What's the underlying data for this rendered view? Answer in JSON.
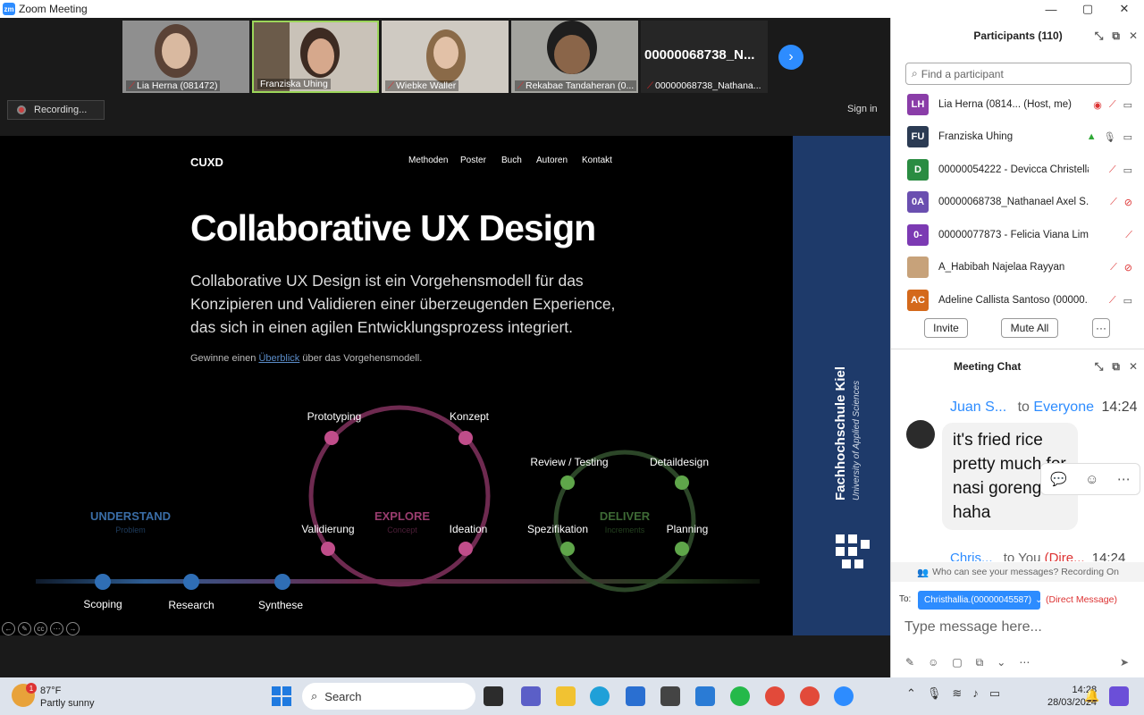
{
  "window": {
    "title": "Zoom Meeting"
  },
  "gallery": {
    "tiles": [
      {
        "name": "Lia Herna (081472)",
        "muted": true
      },
      {
        "name": "Franziska Uhing",
        "muted": false
      },
      {
        "name": "Wiebke Waller",
        "muted": true
      },
      {
        "name": "Rekabae Tandaheran (0...",
        "muted": true
      },
      {
        "name": "00000068738_Nathana...",
        "muted": true,
        "big_label": "00000068738_N..."
      }
    ]
  },
  "recording": {
    "label": "Recording..."
  },
  "signin": {
    "label": "Sign in"
  },
  "shared": {
    "brand": "CUXD",
    "nav": [
      "Methoden",
      "Poster",
      "Buch",
      "Autoren",
      "Kontakt"
    ],
    "title": "Collaborative UX Design",
    "lead": "Collaborative UX Design ist ein Vorgehensmodell für das Konzipieren und Validieren einer überzeugenden Experience, das sich in einen agilen Entwicklungsprozess integriert.",
    "sub_before": "Gewinne einen ",
    "sub_link": "Überblick",
    "sub_after": " über das Vorgehensmodell.",
    "phases": {
      "understand": "UNDERSTAND",
      "understand_sub": "Problem",
      "explore": "EXPLORE",
      "explore_sub": "Concept",
      "deliver": "DELIVER",
      "deliver_sub": "Increments"
    },
    "explore_steps": [
      "Prototyping",
      "Konzept",
      "Validierung",
      "Ideation"
    ],
    "deliver_steps": [
      "Review / Testing",
      "Detaildesign",
      "Spezifikation",
      "Planning"
    ],
    "timeline": [
      "Scoping",
      "Research",
      "Synthese"
    ],
    "sidebar_title": "Fachhochschule Kiel",
    "sidebar_sub": "University of Applied Sciences"
  },
  "participants": {
    "header": "Participants (110)",
    "search_placeholder": "Find a participant",
    "list": [
      {
        "initials": "LH",
        "name": "Lia Herna (0814...",
        "role": "(Host, me)",
        "color": "#8a3da8"
      },
      {
        "initials": "FU",
        "name": "Franziska Uhing",
        "role": "",
        "color": "#2b3b53"
      },
      {
        "initials": "D",
        "name": "00000054222 - Devicca Christella",
        "role": "",
        "color": "#2a8c42"
      },
      {
        "initials": "0A",
        "name": "00000068738_Nathanael Axel S...",
        "role": "",
        "color": "#6a4fb0"
      },
      {
        "initials": "0-",
        "name": "00000077873 - Felicia Viana Lim",
        "role": "",
        "color": "#7c3ab3"
      },
      {
        "initials": "",
        "name": "A_Habibah Najelaa Rayyan",
        "role": "",
        "color": "#c7a27a"
      },
      {
        "initials": "AC",
        "name": "Adeline Callista Santoso (00000...",
        "role": "",
        "color": "#d4691b"
      }
    ],
    "invite": "Invite",
    "mute_all": "Mute All",
    "more": "···"
  },
  "chat": {
    "header": "Meeting Chat",
    "sender": "Juan S...",
    "to_word": "to",
    "to_target": "Everyone",
    "time": "14:24",
    "message": "it's fried rice pretty much for nasi goreng haha",
    "next_sender": "Chris...",
    "next_to": "to You",
    "next_dm": "(Dire...",
    "next_time": "14:24",
    "visibility": "Who can see your messages? Recording On",
    "to_label": "To:",
    "recipient": "Christhallia.(00000045587)",
    "dm_label": "(Direct Message)",
    "input_placeholder": "Type message here..."
  },
  "taskbar": {
    "weather_temp": "87°F",
    "weather_desc": "Partly sunny",
    "weather_badge": "1",
    "search": "Search",
    "time": "14:28",
    "date": "28/03/2024"
  }
}
